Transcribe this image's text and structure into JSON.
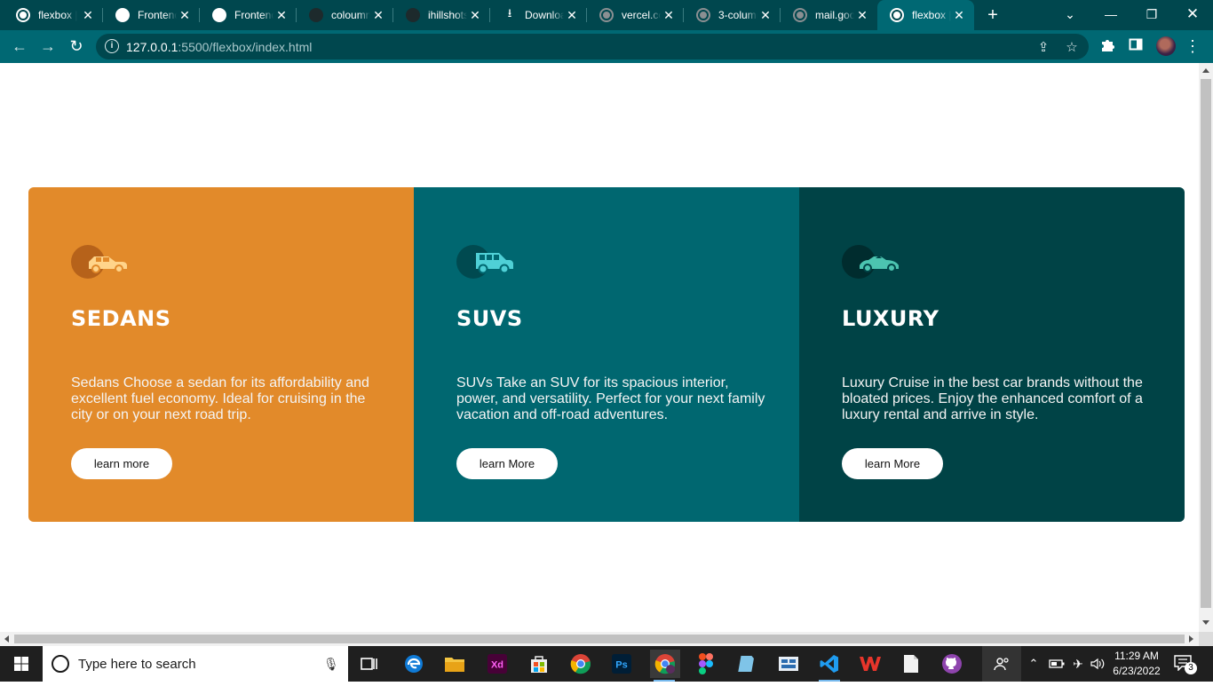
{
  "browser": {
    "tabs": [
      {
        "title": "flexbox |",
        "favicon": "globe-icon"
      },
      {
        "title": "Frontend",
        "favicon": "moon-icon"
      },
      {
        "title": "Frontend",
        "favicon": "image-icon"
      },
      {
        "title": "coloumn",
        "favicon": "dark-logo-icon"
      },
      {
        "title": "ihillshots",
        "favicon": "dark-logo-icon"
      },
      {
        "title": "Download",
        "favicon": "download-icon"
      },
      {
        "title": "vercel.co",
        "favicon": "globe-icon"
      },
      {
        "title": "3-column",
        "favicon": "globe-icon"
      },
      {
        "title": "mail.goo",
        "favicon": "globe-icon"
      },
      {
        "title": "flexbox |",
        "favicon": "globe-icon",
        "active": true
      }
    ],
    "url_host": "127.0.0.1",
    "url_path": ":5500/flexbox/index.html"
  },
  "cards": [
    {
      "title": "SEDANS",
      "text": "Sedans Choose a sedan for its affordability and excellent fuel economy. Ideal for cruising in the city or on your next road trip.",
      "button": "learn more",
      "color": "#e28a2a",
      "icon": "sedan-car-icon"
    },
    {
      "title": "SUVS",
      "text": "SUVs Take an SUV for its spacious interior, power, and versatility. Perfect for your next family vacation and off-road adventures.",
      "button": "learn More",
      "color": "#006770",
      "icon": "suv-car-icon"
    },
    {
      "title": "LUXURY",
      "text": "Luxury Cruise in the best car brands without the bloated prices. Enjoy the enhanced comfort of a luxury rental and arrive in style.",
      "button": "learn More",
      "color": "#004346",
      "icon": "luxury-car-icon"
    }
  ],
  "taskbar": {
    "search_placeholder": "Type here to search",
    "time": "11:29 AM",
    "date": "6/23/2022",
    "notification_count": "3",
    "apps": [
      "task-view-icon",
      "edge-icon",
      "file-explorer-icon",
      "adobe-xd-icon",
      "store-icon",
      "chrome-icon",
      "photoshop-icon",
      "chrome-profile-icon",
      "figma-icon",
      "notepad-icon",
      "screen-app-icon",
      "vscode-icon",
      "wps-icon",
      "file-icon",
      "github-icon"
    ]
  }
}
